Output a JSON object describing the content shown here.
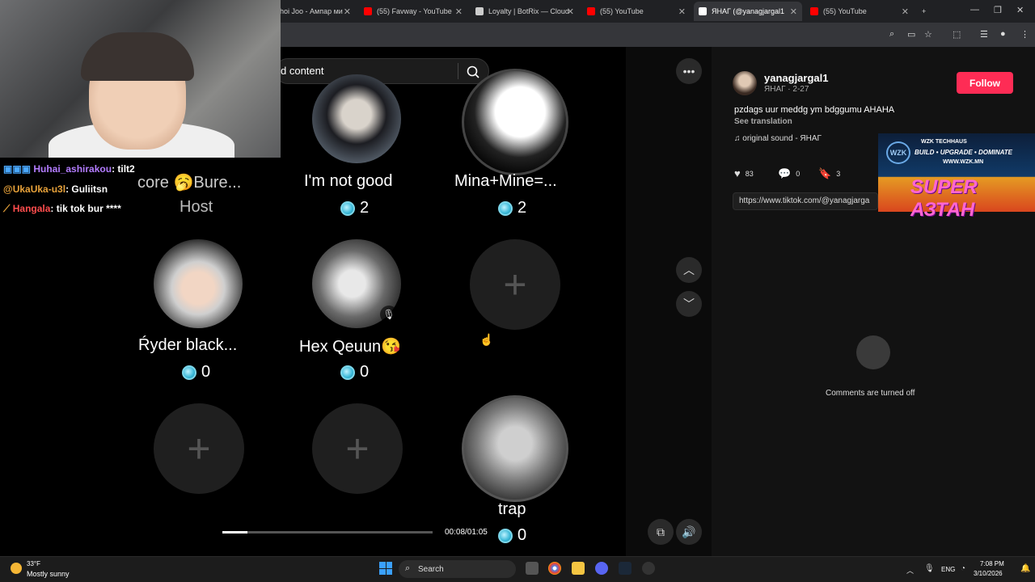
{
  "browser": {
    "tabs": [
      {
        "label": "hoi Joo - Ампар ми",
        "color": "#888888"
      },
      {
        "label": "(55) Favway - YouTube",
        "color": "#ff0000"
      },
      {
        "label": "Loyalty | BotRix — Cloud",
        "color": "#cccccc"
      },
      {
        "label": "(55) YouTube",
        "color": "#ff0000"
      },
      {
        "label": "ЯНАГ (@yanagjargal1",
        "color": "#ffffff"
      },
      {
        "label": "(55) YouTube",
        "color": "#ff0000"
      }
    ],
    "new_tab": "+",
    "window_controls": {
      "minimize": "—",
      "restore": "❐",
      "close": "✕"
    }
  },
  "search": {
    "text": "d content",
    "icon": "search-icon"
  },
  "grid": {
    "row1": [
      {
        "name": "core 🥱Bure...",
        "sub": "Host"
      },
      {
        "name": "I'm not good",
        "coins": "2"
      },
      {
        "name": "Mina+Mine=...",
        "coins": "2"
      }
    ],
    "row2": [
      {
        "name": "Ŕyder black...",
        "coins": "0"
      },
      {
        "name": "Hex Qeuun😘",
        "coins": "0"
      },
      {
        "add": "+"
      }
    ],
    "row3": [
      {
        "add": "+"
      },
      {
        "add": "+"
      },
      {
        "name": "trap",
        "coins": "0"
      }
    ]
  },
  "player": {
    "time": "00:08/01:05",
    "progress": 0.12
  },
  "post": {
    "author": "yanagjargal1",
    "meta": "ЯНАГ · 2-27",
    "follow_label": "Follow",
    "caption": "pzdags uur meddg ym bdggumu AHAHA",
    "see_translation": "See translation",
    "sound": "original sound - ЯНАГ",
    "likes": "83",
    "comments": "0",
    "saves": "3",
    "link": "https://www.tiktok.com/@yanagjarga",
    "comments_off": "Comments are turned off"
  },
  "ad": {
    "brand": "WZK TECHHAUS",
    "slogan": "BUILD • UPGRADE • DOMINATE",
    "url": "WWW.WZK.MN",
    "title": "SUPER АЗТАН",
    "logo": "WZK"
  },
  "chat": [
    {
      "user": "Huhai_ashirakou",
      "msg": ": tilt2",
      "color": "#b37cff"
    },
    {
      "user": "@UkaUka-u3l",
      "msg": ": Guliitsn",
      "color": "#e8a23a"
    },
    {
      "user": "Hangala",
      "msg": ": tik tok bur ****",
      "color": "#ff4d4d"
    }
  ],
  "taskbar": {
    "temp": "33°F",
    "weather": "Mostly sunny",
    "search": "Search",
    "lang": "ENG",
    "time": "7:08 PM",
    "date": "3/10/2026"
  }
}
